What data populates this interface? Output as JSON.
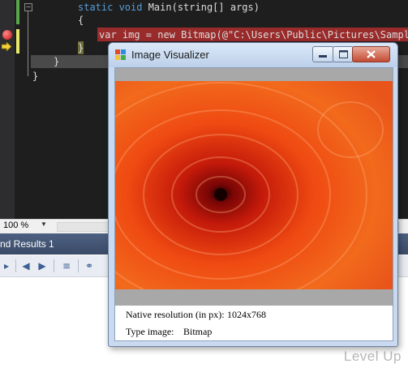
{
  "editor": {
    "line1_keyword": "static void",
    "line1_rest": " Main(string[] args)",
    "brace_open": "{",
    "statement_keyword": "var",
    "statement_rest": " img = new Bitmap(@\"C:\\Users\\Public\\Pictures\\Sample",
    "brace_close_inner": "}",
    "brace_close_method": "}",
    "brace_close_class": "}",
    "collapse_glyph": "−"
  },
  "zoom": {
    "value": "100 %"
  },
  "find_panel": {
    "title": "nd Results 1"
  },
  "visualizer": {
    "title": "Image Visualizer",
    "native_resolution_label": "Native resolution (in px):",
    "native_resolution_value": "1024x768",
    "type_label": "Type image:",
    "type_value": "Bitmap"
  },
  "watermark": "Level Up",
  "colors": {
    "breakpoint_highlight": "#9a2b2b",
    "editor_bg": "#1e1e1e",
    "keyword": "#569cd6"
  }
}
